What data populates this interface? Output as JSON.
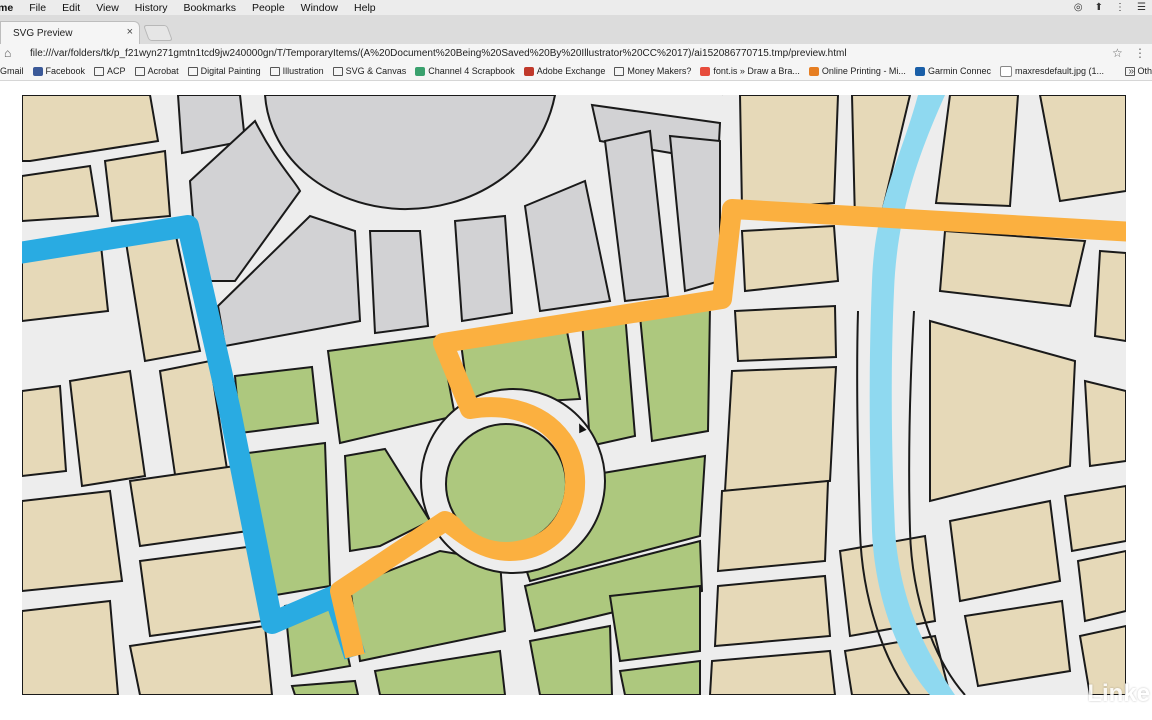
{
  "menubar": {
    "items": [
      "me",
      "File",
      "Edit",
      "View",
      "History",
      "Bookmarks",
      "People",
      "Window",
      "Help"
    ]
  },
  "tab": {
    "title": "SVG Preview",
    "close": "×"
  },
  "address": {
    "url": "file:///var/folders/tk/p_f21wyn271gmtn1tcd9jw240000gn/T/TemporaryItems/(A%20Document%20Being%20Saved%20By%20Illustrator%20CC%2017)/ai152086770715.tmp/preview.html"
  },
  "bookmarks": [
    {
      "label": "Gmail",
      "icon": "gmail-icon"
    },
    {
      "label": "Facebook",
      "icon": "facebook-icon",
      "color": "#3b5998"
    },
    {
      "label": "ACP",
      "icon": "folder-icon"
    },
    {
      "label": "Acrobat",
      "icon": "folder-icon"
    },
    {
      "label": "Digital Painting",
      "icon": "folder-icon"
    },
    {
      "label": "Illustration",
      "icon": "folder-icon"
    },
    {
      "label": "SVG & Canvas",
      "icon": "folder-icon"
    },
    {
      "label": "Channel 4 Scrapbook",
      "icon": "channel4-icon",
      "color": "#3aa16e"
    },
    {
      "label": "Adobe Exchange",
      "icon": "adobe-exchange-icon",
      "color": "#c0392b"
    },
    {
      "label": "Money Makers?",
      "icon": "folder-icon"
    },
    {
      "label": "font.is » Draw a Bra...",
      "icon": "fontis-icon",
      "color": "#e74c3c"
    },
    {
      "label": "Online Printing - Mi...",
      "icon": "printing-icon",
      "color": "#e67e22"
    },
    {
      "label": "Garmin Connec",
      "icon": "garmin-icon",
      "color": "#1a5fa8"
    },
    {
      "label": "maxresdefault.jpg (1...",
      "icon": "file-icon"
    }
  ],
  "bookmarks_more": "»",
  "bookmarks_other": "Oth",
  "map_colors": {
    "block": "#e6d9b8",
    "gray_block": "#d2d2d4",
    "park": "#adc87e",
    "road": "#ededed",
    "outline": "#1a1a1a",
    "river": "#8fd9f0",
    "route_orange": "#fbb040",
    "route_blue": "#29abe2"
  },
  "watermark": "Linke"
}
